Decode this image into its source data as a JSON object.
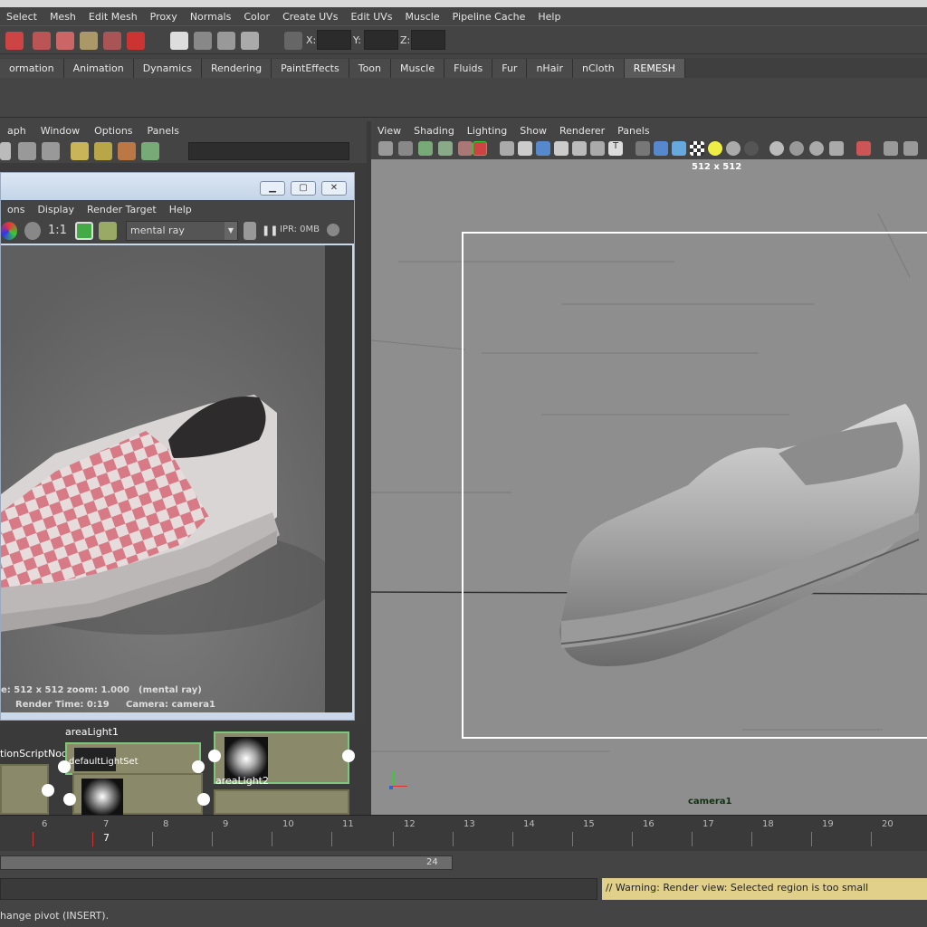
{
  "main_menu": [
    "Select",
    "Mesh",
    "Edit Mesh",
    "Proxy",
    "Normals",
    "Color",
    "Create UVs",
    "Edit UVs",
    "Muscle",
    "Pipeline Cache",
    "Help"
  ],
  "status_line": {
    "x_label": "X:",
    "y_label": "Y:",
    "z_label": "Z:"
  },
  "shelf_tabs": [
    "ormation",
    "Animation",
    "Dynamics",
    "Rendering",
    "PaintEffects",
    "Toon",
    "Muscle",
    "Fluids",
    "Fur",
    "nHair",
    "nCloth",
    "REMESH"
  ],
  "shelf_active": "REMESH",
  "hypershade_menu": [
    "aph",
    "Window",
    "Options",
    "Panels"
  ],
  "render_view": {
    "menu": [
      "ons",
      "Display",
      "Render Target",
      "Help"
    ],
    "ratio": "1:1",
    "renderer": "mental ray",
    "ipr": "IPR: 0MB",
    "info_line1": "e: 512 x 512 zoom: 1.000",
    "info_line1b": "(mental ray)",
    "info_line2": "Render Time: 0:19",
    "info_line2b": "Camera: camera1"
  },
  "nodes": {
    "label_arealight1": "areaLight1",
    "label_script": "tionScriptNod",
    "label_overlap": "defaultLightSet",
    "label_arealight2": "areaLight2"
  },
  "viewport": {
    "menu": [
      "View",
      "Shading",
      "Lighting",
      "Show",
      "Renderer",
      "Panels"
    ],
    "resolution": "512 x 512",
    "camera": "camera1"
  },
  "timeline": {
    "ticks": [
      "6",
      "7",
      "8",
      "9",
      "10",
      "11",
      "12",
      "13",
      "14",
      "15",
      "16",
      "17",
      "18",
      "19",
      "20"
    ],
    "current": "7"
  },
  "range": {
    "end_value": "24"
  },
  "command": {
    "warning": "// Warning: Render view: Selected region is too small"
  },
  "help_line": "hange pivot (INSERT)."
}
